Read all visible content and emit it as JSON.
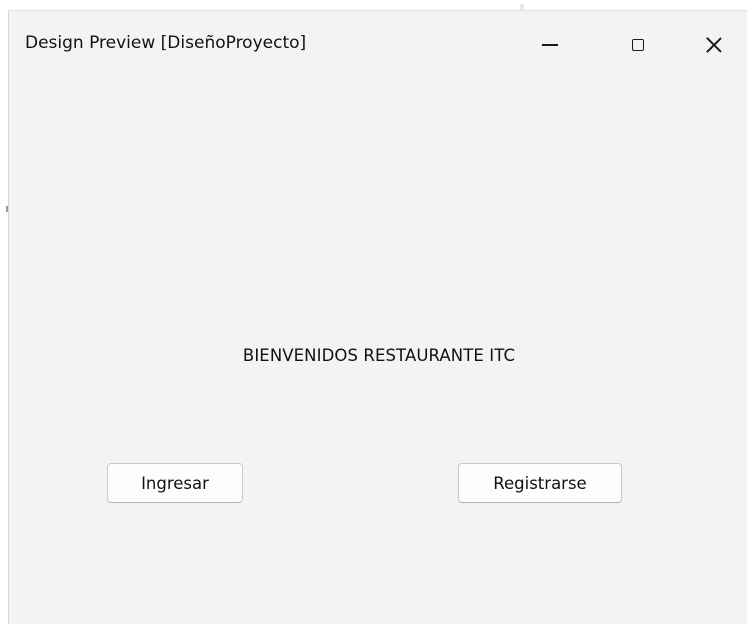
{
  "window": {
    "title": "Design Preview [DiseñoProyecto]",
    "controls": {
      "minimize_icon": "minimize-icon",
      "maximize_icon": "maximize-icon",
      "close_icon": "close-icon"
    }
  },
  "main": {
    "welcome_text": "BIENVENIDOS RESTAURANTE ITC",
    "buttons": {
      "login_label": "Ingresar",
      "register_label": "Registrarse"
    }
  },
  "colors": {
    "window_background": "#f3f3f3",
    "button_background": "#fdfdfd",
    "button_border": "#c9c9c9",
    "text": "#111111"
  }
}
